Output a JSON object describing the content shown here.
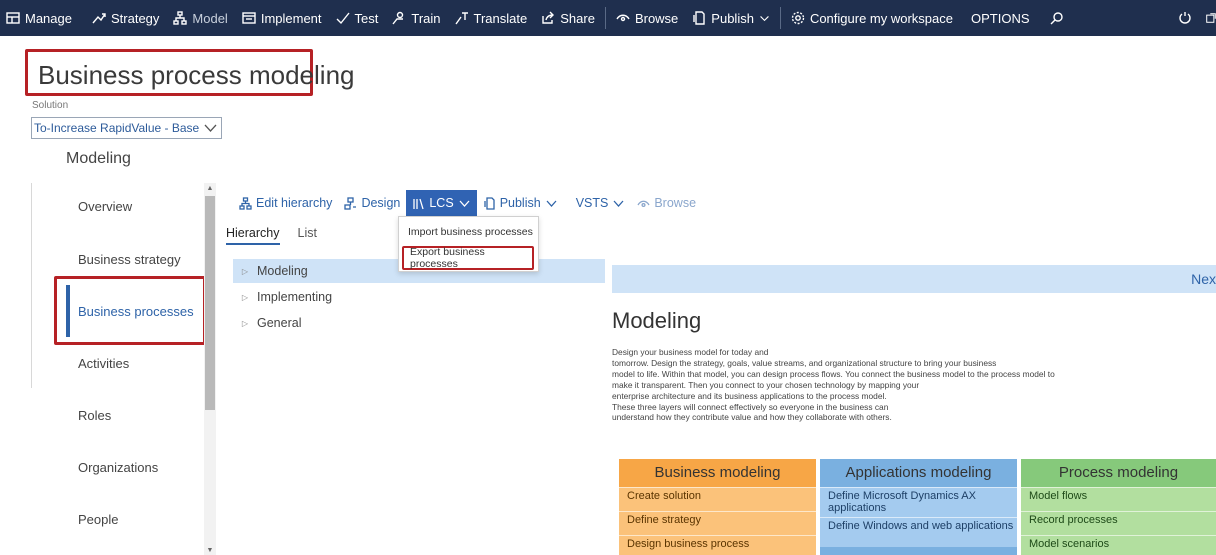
{
  "topnav": {
    "items": [
      {
        "label": "Manage",
        "icon": "manage-icon"
      },
      {
        "label": "Strategy",
        "icon": "strategy-icon"
      },
      {
        "label": "Model",
        "icon": "model-icon"
      },
      {
        "label": "Implement",
        "icon": "implement-icon"
      },
      {
        "label": "Test",
        "icon": "checkmark-icon"
      },
      {
        "label": "Train",
        "icon": "train-icon"
      },
      {
        "label": "Translate",
        "icon": "translate-icon"
      },
      {
        "label": "Share",
        "icon": "share-icon"
      },
      {
        "label": "Browse",
        "icon": "eye-icon"
      },
      {
        "label": "Publish",
        "icon": "publish-icon"
      },
      {
        "label": "Configure my workspace",
        "icon": "gear-icon"
      },
      {
        "label": "OPTIONS"
      }
    ],
    "search_icon": "search-icon",
    "refresh_icon": "refresh-icon",
    "popout_icon": "popout-icon"
  },
  "header": {
    "title": "Business process modeling",
    "solution_label": "Solution",
    "solution_value": "To-Increase RapidValue - Base",
    "section": "Modeling"
  },
  "sidebar": {
    "items": [
      {
        "label": "Overview"
      },
      {
        "label": "Business strategy"
      },
      {
        "label": "Business processes",
        "active": true
      },
      {
        "label": "Activities"
      },
      {
        "label": "Roles"
      },
      {
        "label": "Organizations"
      },
      {
        "label": "People"
      }
    ]
  },
  "toolbar": {
    "edit_hierarchy": "Edit hierarchy",
    "design": "Design",
    "lcs": "LCS",
    "publish": "Publish",
    "vsts": "VSTS",
    "browse": "Browse"
  },
  "lcs_menu": {
    "import": "Import business processes",
    "export": "Export business processes"
  },
  "tabs": {
    "hierarchy": "Hierarchy",
    "list": "List"
  },
  "tree": {
    "nodes": [
      {
        "label": "Modeling",
        "selected": true
      },
      {
        "label": "Implementing"
      },
      {
        "label": "General"
      }
    ]
  },
  "detail": {
    "next": "Nex",
    "title": "Modeling",
    "description": [
      "Design your business model for today and",
      "tomorrow. Design the strategy, goals, value streams, and organizational structure to bring your business",
      "model to life. Within that model, you can design process flows. You connect the business model to the process model to",
      "make it transparent. Then you connect to your chosen technology by mapping your",
      "enterprise architecture and its business applications to the process model.",
      "These three layers will connect effectively so everyone in the business can",
      "understand how they contribute value and how they collaborate with others."
    ]
  },
  "cards": {
    "business": {
      "title": "Business modeling",
      "items": [
        "Create solution",
        "Define strategy",
        "Design business process"
      ]
    },
    "applications": {
      "title": "Applications modeling",
      "items": [
        "Define Microsoft Dynamics AX applications",
        "Define Windows and web applications"
      ]
    },
    "process": {
      "title": "Process modeling",
      "items": [
        "Model flows",
        "Record processes",
        "Model scenarios"
      ]
    }
  },
  "colors": {
    "topbar": "#1f2f4e",
    "accent": "#2e63a8",
    "highlight_frame": "#b62125",
    "business_card": "#f7a646",
    "applications_card": "#7ab0e0",
    "process_card": "#86c97b"
  }
}
